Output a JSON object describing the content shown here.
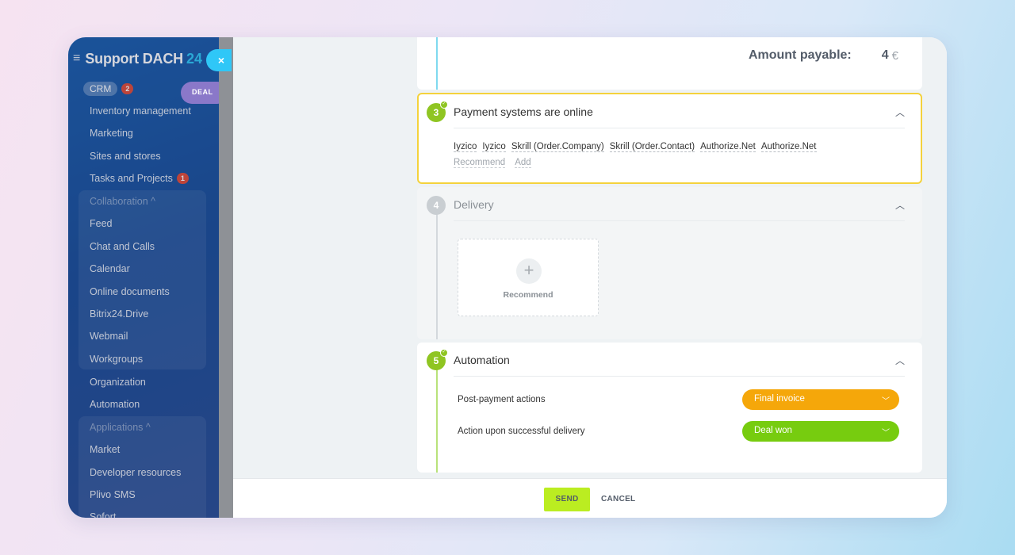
{
  "sidebar": {
    "brand_name": "Support DACH",
    "brand_number": "24",
    "crm_label": "CRM",
    "crm_badge": "2",
    "deal_label": "DEAL",
    "items": [
      {
        "label": "Inventory management"
      },
      {
        "label": "Marketing"
      },
      {
        "label": "Sites and stores"
      },
      {
        "label": "Tasks and Projects",
        "badge": "1"
      },
      {
        "label": "Collaboration ^"
      },
      {
        "label": "Feed"
      },
      {
        "label": "Chat and Calls"
      },
      {
        "label": "Calendar"
      },
      {
        "label": "Online documents"
      },
      {
        "label": "Bitrix24.Drive"
      },
      {
        "label": "Webmail"
      },
      {
        "label": "Workgroups"
      },
      {
        "label": "Organization"
      },
      {
        "label": "Automation"
      },
      {
        "label": "Applications ^"
      },
      {
        "label": "Market"
      },
      {
        "label": "Developer resources"
      },
      {
        "label": "Plivo SMS"
      },
      {
        "label": "Sofort"
      }
    ]
  },
  "close_label": "×",
  "amount": {
    "label": "Amount payable:",
    "value": "4",
    "currency": "€"
  },
  "steps": {
    "payment": {
      "number": "3",
      "title": "Payment systems are online",
      "systems": [
        "Iyzico",
        "Iyzico",
        "Skrill (Order.Company)",
        "Skrill (Order.Contact)",
        "Authorize.Net",
        "Authorize.Net"
      ],
      "recommend_link": "Recommend",
      "add_link": "Add"
    },
    "delivery": {
      "number": "4",
      "title": "Delivery",
      "recommend_label": "Recommend",
      "plus": "+"
    },
    "automation": {
      "number": "5",
      "title": "Automation",
      "rows": [
        {
          "label": "Post-payment actions",
          "value": "Final invoice"
        },
        {
          "label": "Action upon successful delivery",
          "value": "Deal won"
        }
      ]
    }
  },
  "footer": {
    "send_label": "SEND",
    "cancel_label": "CANCEL"
  },
  "colors": {
    "accent_cyan": "#2fc7f7",
    "step_green": "#8fc522",
    "highlight_yellow": "#f4d23c",
    "select_orange": "#f5a70a",
    "select_green": "#77cc0f",
    "send_lime": "#bbed21"
  }
}
